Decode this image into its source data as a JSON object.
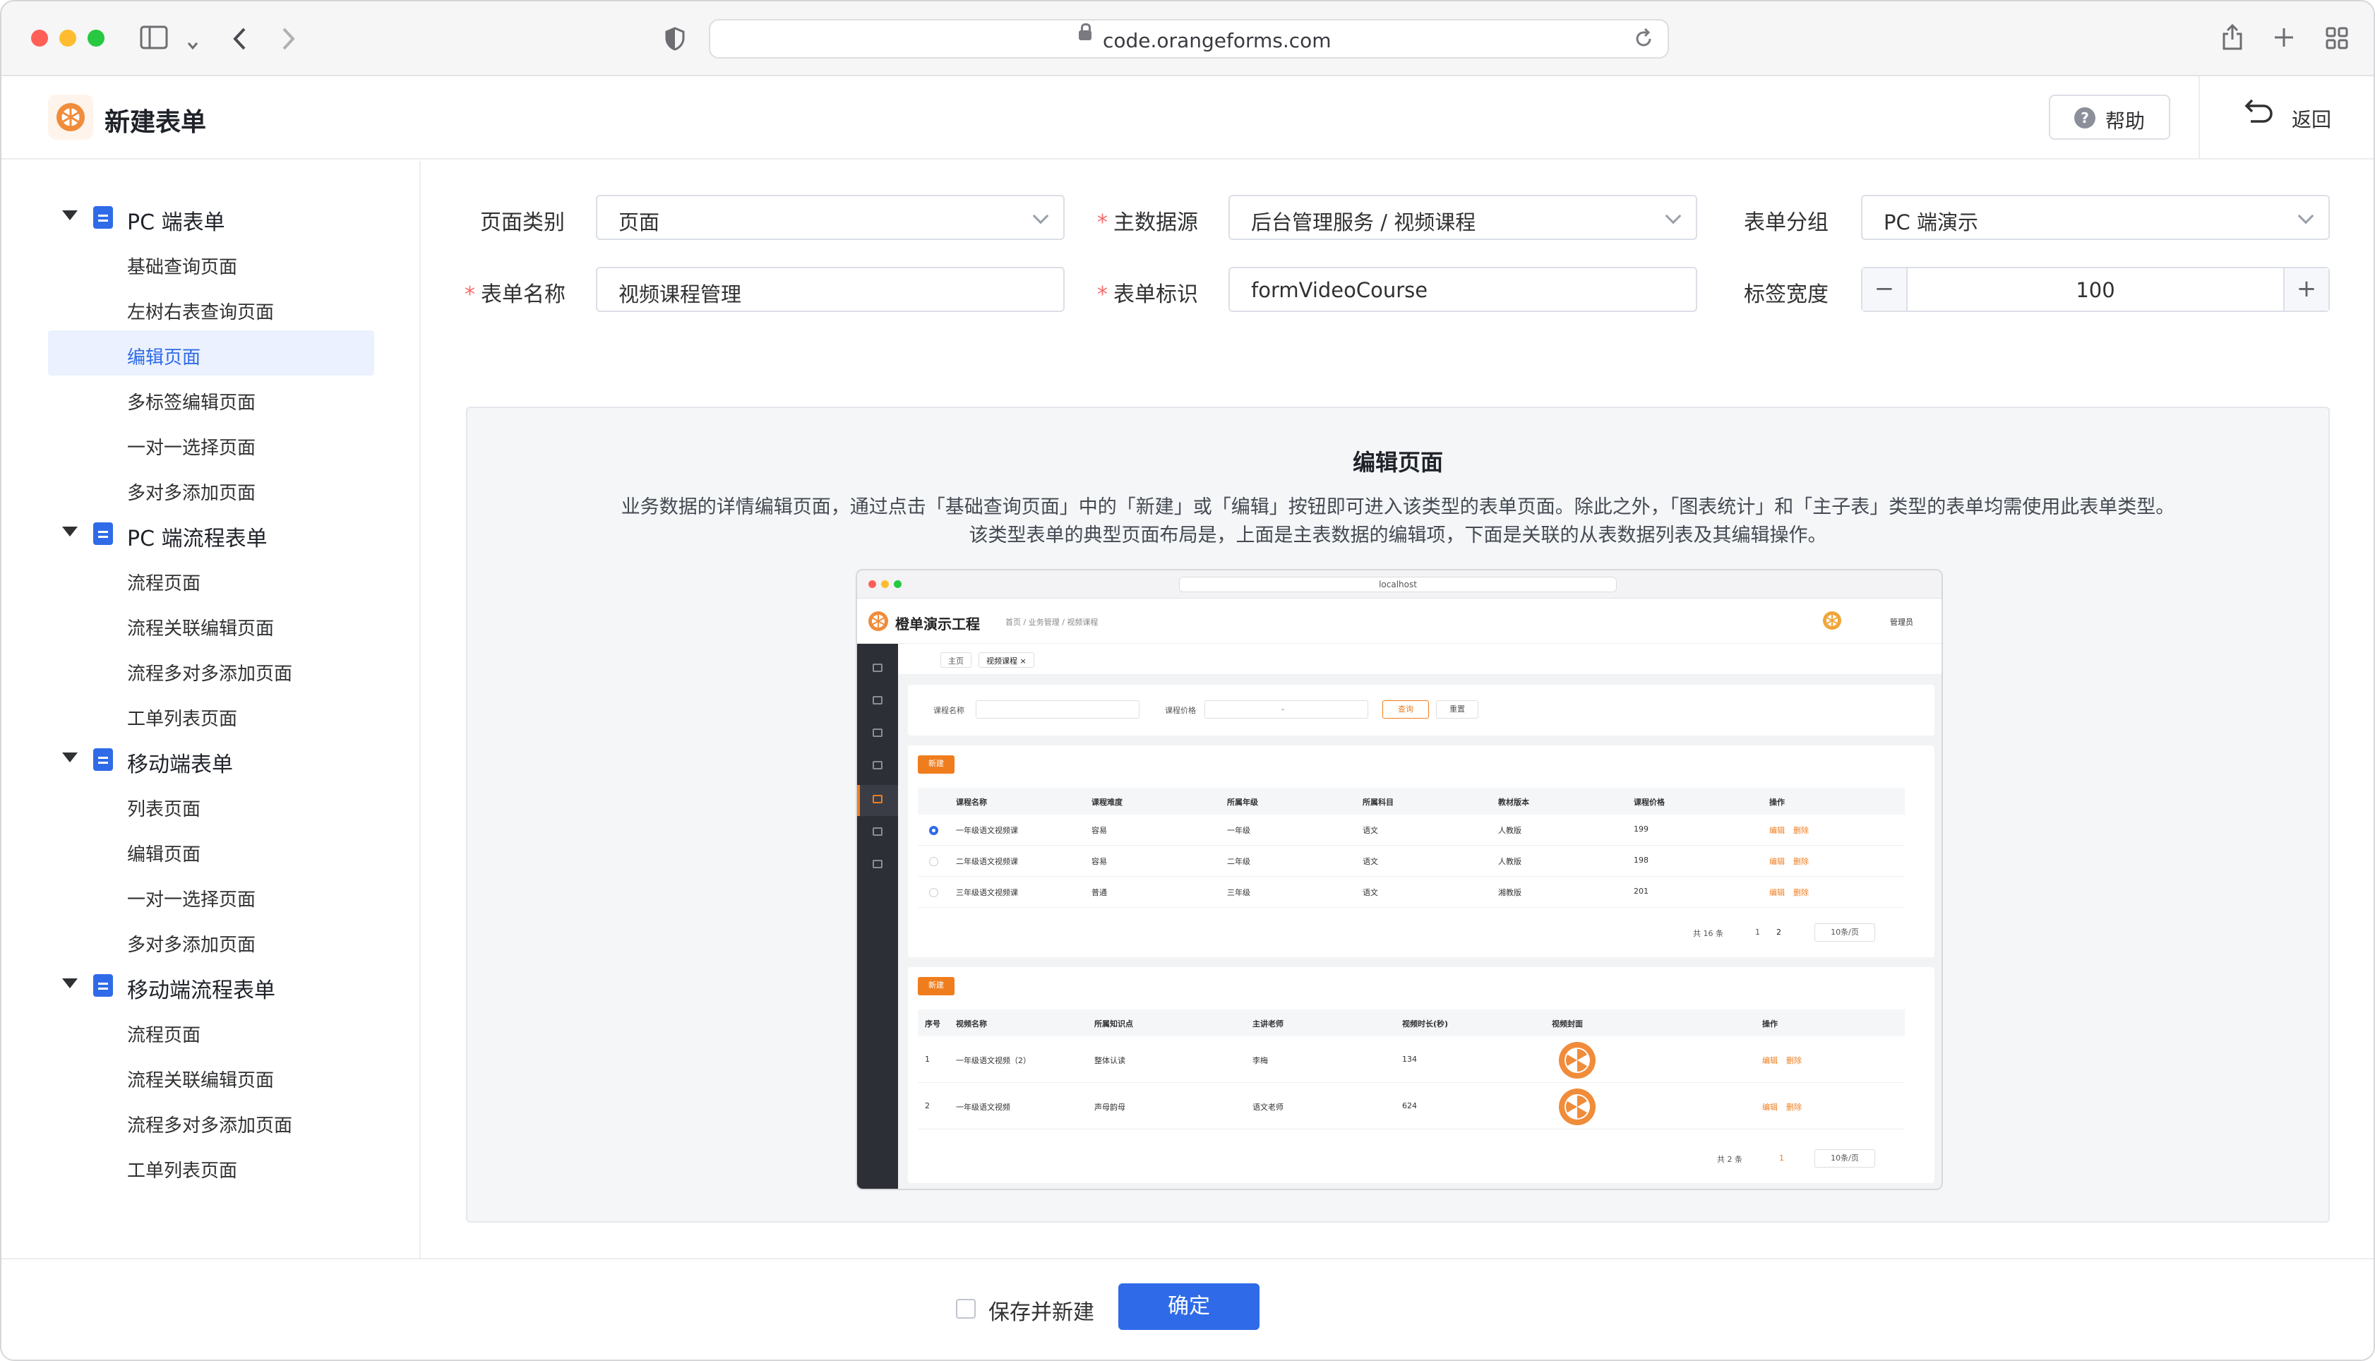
{
  "browser": {
    "url": "code.orangeforms.com",
    "icons": [
      "sidebar-toggle-icon",
      "chevron-down-icon",
      "back-icon",
      "forward-icon",
      "shield-icon",
      "lock-icon",
      "reload-icon",
      "share-icon",
      "new-tab-icon",
      "tab-overview-icon"
    ]
  },
  "app": {
    "title": "新建表单",
    "help_label": "帮助",
    "back_label": "返回"
  },
  "sidebar": {
    "groups": [
      {
        "label": "PC 端表单",
        "items": [
          "基础查询页面",
          "左树右表查询页面",
          "编辑页面",
          "多标签编辑页面",
          "一对一选择页面",
          "多对多添加页面"
        ]
      },
      {
        "label": "PC 端流程表单",
        "items": [
          "流程页面",
          "流程关联编辑页面",
          "流程多对多添加页面",
          "工单列表页面"
        ]
      },
      {
        "label": "移动端表单",
        "items": [
          "列表页面",
          "编辑页面",
          "一对一选择页面",
          "多对多添加页面"
        ]
      },
      {
        "label": "移动端流程表单",
        "items": [
          "流程页面",
          "流程关联编辑页面",
          "流程多对多添加页面",
          "工单列表页面"
        ]
      }
    ],
    "active": "编辑页面"
  },
  "form": {
    "page_type": {
      "label": "页面类别",
      "value": "页面"
    },
    "main_source": {
      "label": "主数据源",
      "value": "后台管理服务 / 视频课程"
    },
    "form_group": {
      "label": "表单分组",
      "value": "PC 端演示"
    },
    "form_name": {
      "label": "表单名称",
      "value": "视频课程管理"
    },
    "form_key": {
      "label": "表单标识",
      "value": "formVideoCourse"
    },
    "label_width": {
      "label": "标签宽度",
      "value": "100",
      "minus": "−",
      "plus": "+"
    },
    "required_mark": "*"
  },
  "preview": {
    "title": "编辑页面",
    "desc_line1": "业务数据的详情编辑页面，通过点击「基础查询页面」中的「新建」或「编辑」按钮即可进入该类型的表单页面。除此之外，「图表统计」和「主子表」类型的表单均需使用此表单类型。",
    "desc_line2": "该类型表单的典型页面布局是，上面是主表数据的编辑项，下面是关联的从表数据列表及其编辑操作。",
    "mini": {
      "url": "localhost",
      "app_name": "橙单演示工程",
      "breadcrumb": "首页  /  业务管理  /  视频课程",
      "user": "管理员",
      "tabs": [
        "主页",
        "视频课程 ×"
      ],
      "filter_name_label": "课程名称",
      "filter_price_label": "课程价格",
      "filter_sep": "-",
      "search_label": "查询",
      "reset_label": "重置",
      "new_label": "新建",
      "table1": {
        "headers": [
          "课程名称",
          "课程难度",
          "所属年级",
          "所属科目",
          "教材版本",
          "课程价格",
          "操作"
        ],
        "rows": [
          [
            "一年级语文视频课",
            "容易",
            "一年级",
            "语文",
            "人教版",
            "199"
          ],
          [
            "二年级语文视频课",
            "容易",
            "二年级",
            "语文",
            "人教版",
            "198"
          ],
          [
            "三年级语文视频课",
            "普通",
            "三年级",
            "语文",
            "湘教版",
            "201"
          ]
        ],
        "total": "共 16 条",
        "pages": [
          "1",
          "2"
        ],
        "page_size": "10条/页"
      },
      "table2": {
        "headers": [
          "序号",
          "视频名称",
          "所属知识点",
          "主讲老师",
          "视频时长(秒)",
          "视频封面",
          "操作"
        ],
        "rows": [
          [
            "1",
            "一年级语文视频（2）",
            "整体认读",
            "李梅",
            "134"
          ],
          [
            "2",
            "一年级语文视频",
            "声母韵母",
            "语文老师",
            "624"
          ]
        ],
        "total": "共 2 条",
        "pages": [
          "1"
        ],
        "page_size": "10条/页"
      },
      "edit_label": "编辑",
      "delete_label": "删除"
    }
  },
  "footer": {
    "save_new_label": "保存并新建",
    "confirm_label": "确定"
  },
  "colors": {
    "primary": "#2f6be8",
    "accent": "#f08c3a",
    "danger": "#f56c6c"
  }
}
